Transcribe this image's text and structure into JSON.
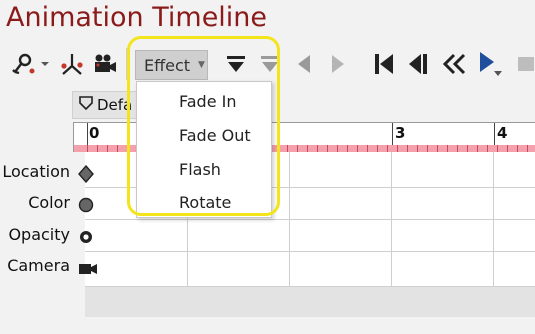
{
  "title": "Animation Timeline",
  "toolbar": {
    "effect_label": "Effect",
    "icons": [
      "path-tool-icon",
      "dropdown-caret-icon",
      "motion-path-icon",
      "camera-icon",
      "keyframe-down-icon",
      "keyframe-down-disabled-icon",
      "previous-icon",
      "next-icon",
      "first-frame-icon",
      "step-back-icon",
      "rewind-icon",
      "play-icon",
      "stop-icon"
    ]
  },
  "layer_tab": {
    "label": "Defa"
  },
  "ruler": {
    "labels": [
      "0",
      "3",
      "4"
    ]
  },
  "rows": [
    {
      "label": "Location",
      "icon": "diamond-icon"
    },
    {
      "label": "Color",
      "icon": "circle-icon"
    },
    {
      "label": "Opacity",
      "icon": "ring-icon"
    },
    {
      "label": "Camera",
      "icon": "camera-icon"
    }
  ],
  "effect_menu": {
    "items": [
      {
        "label": "Fade In"
      },
      {
        "label": "Fade Out"
      },
      {
        "label": "Flash"
      },
      {
        "label": "Rotate"
      }
    ]
  },
  "colors": {
    "title": "#8b1b1b",
    "highlight": "#f2e51c",
    "ruler_band": "#f4a1ad",
    "accent": "#1f4e9c"
  }
}
